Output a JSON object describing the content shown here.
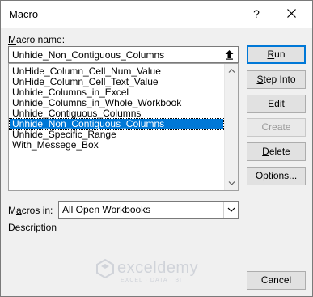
{
  "window": {
    "title": "Macro",
    "help": "?"
  },
  "macro_name": {
    "label_underlined": "M",
    "label_rest": "acro name:",
    "value": "Unhide_Non_Contiguous_Columns"
  },
  "macros": [
    "UnHide_Column_Cell_Num_Value",
    "UnHide_Column_Cell_Text_Value",
    "Unhide_Columns_in_Excel",
    "Unhide_Columns_in_Whole_Workbook",
    "Unhide_Contiguous_Columns",
    "Unhide_Non_Contiguous_Columns",
    "Unhide_Specific_Range",
    "With_Messege_Box"
  ],
  "selected_index": 5,
  "buttons": {
    "run": {
      "u": "R",
      "rest": "un"
    },
    "step_into": {
      "u": "S",
      "rest": "tep Into"
    },
    "edit": {
      "u": "E",
      "rest": "dit"
    },
    "create": {
      "pre": "C",
      "u": "r",
      "rest": "eate"
    },
    "delete": {
      "u": "D",
      "rest": "elete"
    },
    "options": {
      "u": "O",
      "rest": "ptions..."
    },
    "cancel": "Cancel"
  },
  "macros_in": {
    "label_pre": "M",
    "label_u": "a",
    "label_rest": "cros in:",
    "value": "All Open Workbooks"
  },
  "description_label": "Description",
  "watermark": {
    "brand": "exceldemy",
    "tagline": "EXCEL · DATA · BI"
  }
}
